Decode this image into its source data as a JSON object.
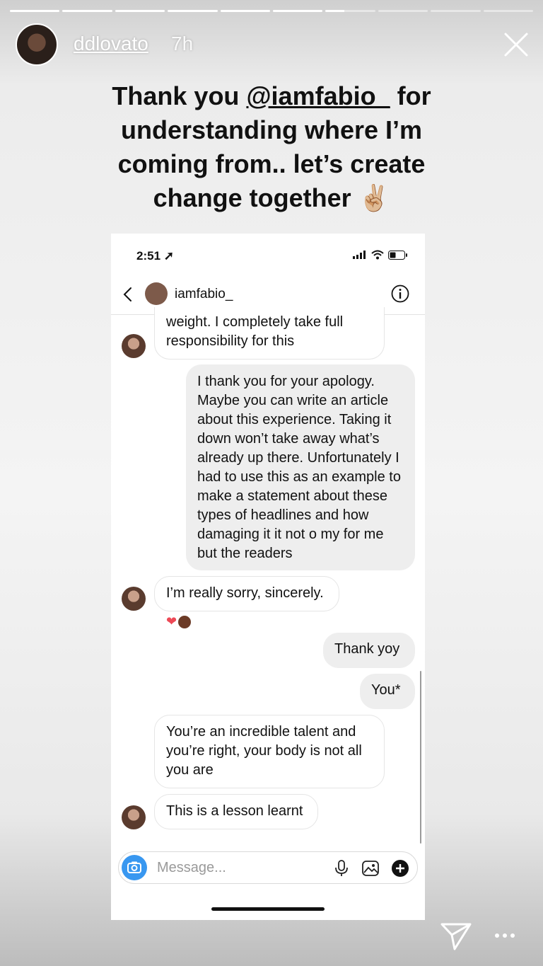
{
  "story": {
    "username": "ddlovato",
    "time_ago": "7h",
    "segments_total": 10,
    "segments_done": 6,
    "current_segment_progress": 0.38
  },
  "caption": {
    "part1": "Thank you ",
    "mention": "@iamfabio_",
    "part2": " for understanding where I’m coming from.. let’s create change together ✌🏼"
  },
  "screenshot": {
    "status_time": "2:51",
    "contact_name": "iamfabio_",
    "messages": [
      {
        "from": "them",
        "text": "weight. I completely take full responsibility for this"
      },
      {
        "from": "me",
        "text": "I thank you for your apology. Maybe you can write an article about this experience. Taking it down won’t take away what’s already up there. Unfortunately I had to use this as an example to make a statement about these types of headlines and how damaging it it not o my for me but the readers"
      },
      {
        "from": "them",
        "text": "I’m really sorry, sincerely."
      },
      {
        "from": "me",
        "text": "Thank yoy"
      },
      {
        "from": "me",
        "text": "You*"
      },
      {
        "from": "them",
        "text": "You’re an incredible talent and you’re right, your body is not all you are"
      },
      {
        "from": "them",
        "text": "This is a lesson learnt"
      }
    ],
    "reaction": "heart",
    "composer_placeholder": "Message..."
  },
  "icons": {
    "close": "close-icon",
    "send": "send-icon",
    "more": "more-icon",
    "back": "chevron-left-icon",
    "info": "info-icon",
    "camera": "camera-icon",
    "mic": "microphone-icon",
    "gallery": "gallery-icon",
    "add": "plus-circle-icon"
  }
}
